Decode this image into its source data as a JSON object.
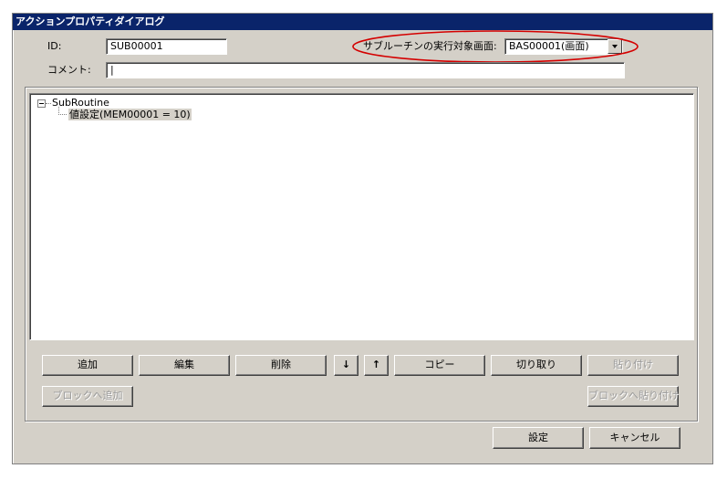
{
  "window": {
    "title": "アクションプロパティダイアログ"
  },
  "form": {
    "id_label": "ID:",
    "id_value": "SUB00001",
    "target_label": "サブルーチンの実行対象画面:",
    "target_value": "BAS00001(画面)",
    "comment_label": "コメント:",
    "comment_value": "|"
  },
  "tree": {
    "root_label": "SubRoutine",
    "root_expander": "−",
    "children": [
      {
        "label": "値設定(MEM00001 = 10)"
      }
    ]
  },
  "buttons": {
    "add": "追加",
    "edit": "編集",
    "delete": "削除",
    "move_down": "↓",
    "move_up": "↑",
    "copy": "コピー",
    "cut": "切り取り",
    "paste": "貼り付け",
    "add_to_block": "ブロックへ追加",
    "paste_to_block": "ブロックへ貼り付け",
    "ok": "設定",
    "cancel": "キャンセル"
  },
  "annotation": {
    "color": "#d40000"
  }
}
